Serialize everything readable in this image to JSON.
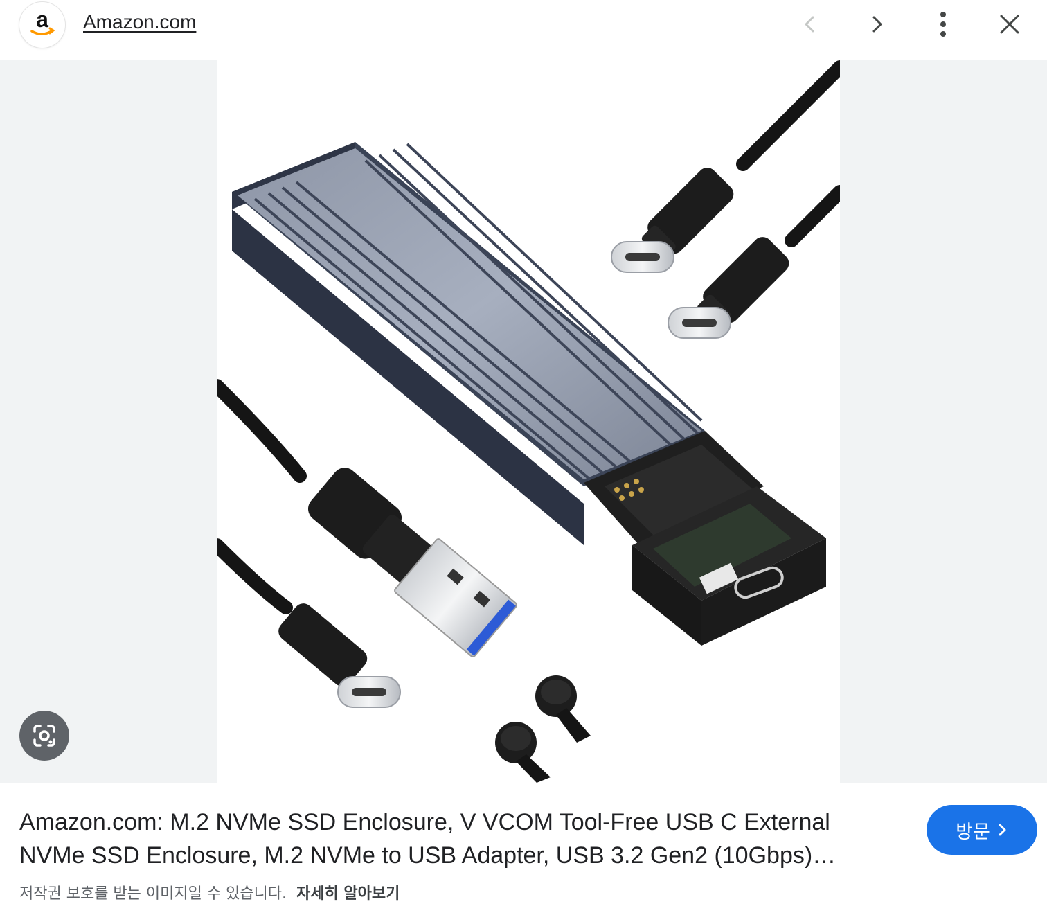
{
  "header": {
    "favicon_letter": "a",
    "favicon_icon": "amazon-logo-icon",
    "site_name": "Amazon.com",
    "prev_icon": "chevron-left-icon",
    "next_icon": "chevron-right-icon",
    "more_icon": "more-vert-icon",
    "close_icon": "close-icon"
  },
  "image": {
    "depicts": "M.2 NVMe SSD enclosure with USB-A and USB-C cables",
    "lens_icon": "google-lens-icon"
  },
  "result": {
    "title_line1": "Amazon.com: M.2 NVMe SSD Enclosure, V VCOM Tool-Free USB C External",
    "title_line2": "NVMe SSD Enclosure, M.2 NVMe to USB Adapter, USB 3.2 Gen2 (10Gbps)…",
    "visit_label": "방문",
    "visit_icon": "chevron-right-icon",
    "copyright_notice": "저작권 보호를 받는 이미지일 수 있습니다.",
    "learn_more": "자세히 알아보기"
  },
  "colors": {
    "accent": "#1a73e8",
    "backdrop": "#f1f3f4",
    "icon_gray": "#5f6368",
    "disabled_gray": "#c4c7c5"
  }
}
